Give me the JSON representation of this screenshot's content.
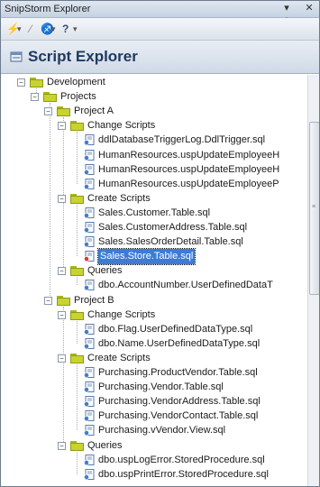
{
  "window": {
    "title": "SnipStorm Explorer",
    "pin_glyph": "▾ ⊥",
    "close_glyph": "✕"
  },
  "toolbar": {
    "tools": [
      {
        "name": "lightning-icon",
        "glyph": "⚡"
      },
      {
        "name": "dropdown-arrow-icon",
        "glyph": "▾"
      },
      {
        "name": "wand-icon",
        "glyph": "⁄"
      },
      {
        "name": "brush-icon",
        "glyph": "♐"
      },
      {
        "name": "dropdown-arrow-icon",
        "glyph": "▾"
      },
      {
        "name": "help-icon",
        "glyph": "?"
      },
      {
        "name": "dropdown-arrow-icon",
        "glyph": "▾"
      }
    ]
  },
  "header": {
    "title": "Script Explorer"
  },
  "tree": [
    {
      "level": 0,
      "type": "folder",
      "label": "Development",
      "expanded": true
    },
    {
      "level": 1,
      "type": "folder",
      "label": "Projects",
      "expanded": true
    },
    {
      "level": 2,
      "type": "folder",
      "label": "Project A",
      "expanded": true
    },
    {
      "level": 3,
      "type": "folder",
      "label": "Change Scripts",
      "expanded": true
    },
    {
      "level": 4,
      "type": "file",
      "label": "ddlDatabaseTriggerLog.DdlTrigger.sql"
    },
    {
      "level": 4,
      "type": "file",
      "label": "HumanResources.uspUpdateEmployeeH"
    },
    {
      "level": 4,
      "type": "file",
      "label": "HumanResources.uspUpdateEmployeeH"
    },
    {
      "level": 4,
      "type": "file",
      "label": "HumanResources.uspUpdateEmployeeP"
    },
    {
      "level": 3,
      "type": "folder",
      "label": "Create Scripts",
      "expanded": true
    },
    {
      "level": 4,
      "type": "file",
      "label": "Sales.Customer.Table.sql"
    },
    {
      "level": 4,
      "type": "file",
      "label": "Sales.CustomerAddress.Table.sql"
    },
    {
      "level": 4,
      "type": "file",
      "label": "Sales.SalesOrderDetail.Table.sql"
    },
    {
      "level": 4,
      "type": "file",
      "label": "Sales.Store.Table.sql",
      "selected": true,
      "red": true
    },
    {
      "level": 3,
      "type": "folder",
      "label": "Queries",
      "expanded": true
    },
    {
      "level": 4,
      "type": "file",
      "label": "dbo.AccountNumber.UserDefinedDataT"
    },
    {
      "level": 2,
      "type": "folder",
      "label": "Project B",
      "expanded": true
    },
    {
      "level": 3,
      "type": "folder",
      "label": "Change Scripts",
      "expanded": true
    },
    {
      "level": 4,
      "type": "file",
      "label": "dbo.Flag.UserDefinedDataType.sql"
    },
    {
      "level": 4,
      "type": "file",
      "label": "dbo.Name.UserDefinedDataType.sql"
    },
    {
      "level": 3,
      "type": "folder",
      "label": "Create Scripts",
      "expanded": true
    },
    {
      "level": 4,
      "type": "file",
      "label": "Purchasing.ProductVendor.Table.sql"
    },
    {
      "level": 4,
      "type": "file",
      "label": "Purchasing.Vendor.Table.sql"
    },
    {
      "level": 4,
      "type": "file",
      "label": "Purchasing.VendorAddress.Table.sql"
    },
    {
      "level": 4,
      "type": "file",
      "label": "Purchasing.VendorContact.Table.sql"
    },
    {
      "level": 4,
      "type": "file",
      "label": "Purchasing.vVendor.View.sql"
    },
    {
      "level": 3,
      "type": "folder",
      "label": "Queries",
      "expanded": true
    },
    {
      "level": 4,
      "type": "file",
      "label": "dbo.uspLogError.StoredProcedure.sql"
    },
    {
      "level": 4,
      "type": "file",
      "label": "dbo.uspPrintError.StoredProcedure.sql"
    }
  ],
  "colors": {
    "selection": "#3d7bd6",
    "folder": "#c9d330",
    "header_text": "#1e3a5f"
  }
}
